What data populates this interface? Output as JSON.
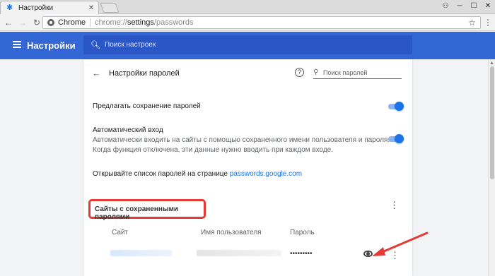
{
  "tab": {
    "title": "Настройки",
    "close_glyph": "✕"
  },
  "window": {
    "user_glyph": "⚇",
    "minimize_glyph": "─",
    "maximize_glyph": "☐",
    "close_glyph": "✕"
  },
  "toolbar": {
    "back_glyph": "←",
    "forward_glyph": "→",
    "reload_glyph": "↻",
    "site_name": "Chrome",
    "url_scheme": "chrome://",
    "url_host": "settings",
    "url_path": "/passwords",
    "star_glyph": "☆",
    "menu_glyph": "⋮"
  },
  "header": {
    "title": "Настройки",
    "search_placeholder": "Поиск настроек"
  },
  "page": {
    "back_glyph": "←",
    "title": "Настройки паролей",
    "help_glyph": "?",
    "search_placeholder": "Поиск паролей"
  },
  "settings": {
    "offer_save": {
      "label": "Предлагать сохранение паролей",
      "enabled": true
    },
    "auto_signin": {
      "label": "Автоматический вход",
      "description_1": "Автоматически входить на сайты с помощью сохраненного имени пользователя и пароля.",
      "description_2": "Когда функция отключена, эти данные нужно вводить при каждом входе.",
      "enabled": true
    },
    "view_passwords": {
      "text": "Открывайте список паролей на странице ",
      "link": "passwords.google.com"
    }
  },
  "saved": {
    "heading": "Сайты с сохраненными паролями",
    "more_glyph": "⋮",
    "columns": {
      "site": "Сайт",
      "username": "Имя пользователя",
      "password": "Пароль"
    },
    "rows": [
      {
        "password": "•••••••••",
        "more_glyph": "⋮"
      }
    ]
  },
  "colors": {
    "header_blue": "#3367d6",
    "search_blue": "#2a56c6",
    "toggle_blue": "#1a73e8",
    "highlight_red": "#e53935"
  },
  "icons": [
    "settings-gear-icon",
    "chrome-icon",
    "star-icon",
    "menu-icon",
    "hamburger-icon",
    "search-icon",
    "back-icon",
    "help-icon",
    "eye-icon",
    "more-vert-icon"
  ]
}
